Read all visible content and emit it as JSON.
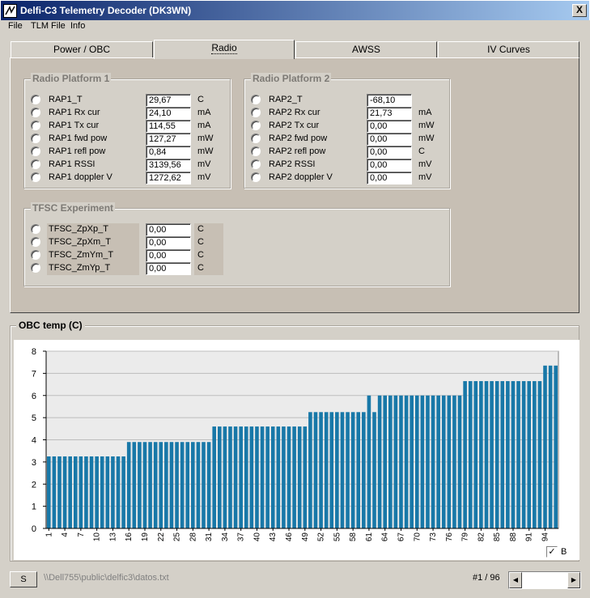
{
  "window": {
    "title": "Delfi-C3 Telemetry Decoder (DK3WN)",
    "close": "X"
  },
  "menu": [
    "File",
    "TLM File",
    "Info"
  ],
  "tabs": [
    {
      "label": "Power / OBC",
      "active": false
    },
    {
      "label": "Radio",
      "active": true
    },
    {
      "label": "AWSS",
      "active": false
    },
    {
      "label": "IV Curves",
      "active": false
    }
  ],
  "rp1": {
    "title": "Radio Platform 1",
    "rows": [
      {
        "label": "RAP1_T",
        "value": "29,67",
        "unit": "C"
      },
      {
        "label": "RAP1 Rx cur",
        "value": "24,10",
        "unit": "mA"
      },
      {
        "label": "RAP1 Tx cur",
        "value": "114,55",
        "unit": "mA"
      },
      {
        "label": "RAP1 fwd pow",
        "value": "127,27",
        "unit": "mW"
      },
      {
        "label": "RAP1 refl pow",
        "value": "0,84",
        "unit": "mW"
      },
      {
        "label": "RAP1 RSSI",
        "value": "3139,56",
        "unit": "mV"
      },
      {
        "label": "RAP1 doppler V",
        "value": "1272,62",
        "unit": "mV"
      }
    ]
  },
  "rp2": {
    "title": "Radio Platform 2",
    "rows": [
      {
        "label": "RAP2_T",
        "value": "-68,10",
        "unit": ""
      },
      {
        "label": "RAP2 Rx cur",
        "value": "21,73",
        "unit": "mA"
      },
      {
        "label": "RAP2 Tx cur",
        "value": "0,00",
        "unit": "mW"
      },
      {
        "label": "RAP2 fwd pow",
        "value": "0,00",
        "unit": "mW"
      },
      {
        "label": "RAP2 refl pow",
        "value": "0,00",
        "unit": "C"
      },
      {
        "label": "RAP2 RSSI",
        "value": "0,00",
        "unit": "mV"
      },
      {
        "label": "RAP2 doppler V",
        "value": "0,00",
        "unit": "mV"
      }
    ]
  },
  "tfsc": {
    "title": "TFSC Experiment",
    "rows": [
      {
        "label": "TFSC_ZpXp_T",
        "value": "0,00",
        "unit": "C"
      },
      {
        "label": "TFSC_ZpXm_T",
        "value": "0,00",
        "unit": "C"
      },
      {
        "label": "TFSC_ZmYm_T",
        "value": "0,00",
        "unit": "C"
      },
      {
        "label": "TFSC_ZmYp_T",
        "value": "0,00",
        "unit": "C"
      }
    ]
  },
  "chart_title": "OBC temp (C)",
  "legend_label": "B",
  "legend_check": "✓",
  "bottom": {
    "button": "S",
    "path": "\\\\Dell755\\public\\delfic3\\datos.txt",
    "counter": "#1 / 96",
    "scroll_left": "◀",
    "scroll_right": "▶"
  },
  "colors": {
    "bar": "#1878a8",
    "titlebar": "#0a246a"
  },
  "chart_data": {
    "type": "bar",
    "title": "OBC temp (C)",
    "ylim": [
      0,
      8
    ],
    "yticks": [
      0,
      1,
      2,
      3,
      4,
      5,
      6,
      7,
      8
    ],
    "xtick_labels": [
      "1",
      "4",
      "7",
      "10",
      "13",
      "16",
      "19",
      "22",
      "25",
      "28",
      "31",
      "34",
      "37",
      "40",
      "43",
      "46",
      "49",
      "52",
      "55",
      "58",
      "61",
      "64",
      "67",
      "70",
      "73",
      "76",
      "79",
      "82",
      "85",
      "88",
      "91",
      "94"
    ],
    "x": [
      1,
      2,
      3,
      4,
      5,
      6,
      7,
      8,
      9,
      10,
      11,
      12,
      13,
      14,
      15,
      16,
      17,
      18,
      19,
      20,
      21,
      22,
      23,
      24,
      25,
      26,
      27,
      28,
      29,
      30,
      31,
      32,
      33,
      34,
      35,
      36,
      37,
      38,
      39,
      40,
      41,
      42,
      43,
      44,
      45,
      46,
      47,
      48,
      49,
      50,
      51,
      52,
      53,
      54,
      55,
      56,
      57,
      58,
      59,
      60,
      61,
      62,
      63,
      64,
      65,
      66,
      67,
      68,
      69,
      70,
      71,
      72,
      73,
      74,
      75,
      76,
      77,
      78,
      79,
      80,
      81,
      82,
      83,
      84,
      85,
      86,
      87,
      88,
      89,
      90,
      91,
      92,
      93,
      94,
      95,
      96
    ],
    "values": [
      3.25,
      3.25,
      3.25,
      3.25,
      3.25,
      3.25,
      3.25,
      3.25,
      3.25,
      3.25,
      3.25,
      3.25,
      3.25,
      3.25,
      3.25,
      3.9,
      3.9,
      3.9,
      3.9,
      3.9,
      3.9,
      3.9,
      3.9,
      3.9,
      3.9,
      3.9,
      3.9,
      3.9,
      3.9,
      3.9,
      3.9,
      4.6,
      4.6,
      4.6,
      4.6,
      4.6,
      4.6,
      4.6,
      4.6,
      4.6,
      4.6,
      4.6,
      4.6,
      4.6,
      4.6,
      4.6,
      4.6,
      4.6,
      4.6,
      5.25,
      5.25,
      5.25,
      5.25,
      5.25,
      5.25,
      5.25,
      5.25,
      5.25,
      5.25,
      5.25,
      6.0,
      5.25,
      6.0,
      6.0,
      6.0,
      6.0,
      6.0,
      6.0,
      6.0,
      6.0,
      6.0,
      6.0,
      6.0,
      6.0,
      6.0,
      6.0,
      6.0,
      6.0,
      6.65,
      6.65,
      6.65,
      6.65,
      6.65,
      6.65,
      6.65,
      6.65,
      6.65,
      6.65,
      6.65,
      6.65,
      6.65,
      6.65,
      6.65,
      7.35,
      7.35,
      7.35
    ]
  }
}
